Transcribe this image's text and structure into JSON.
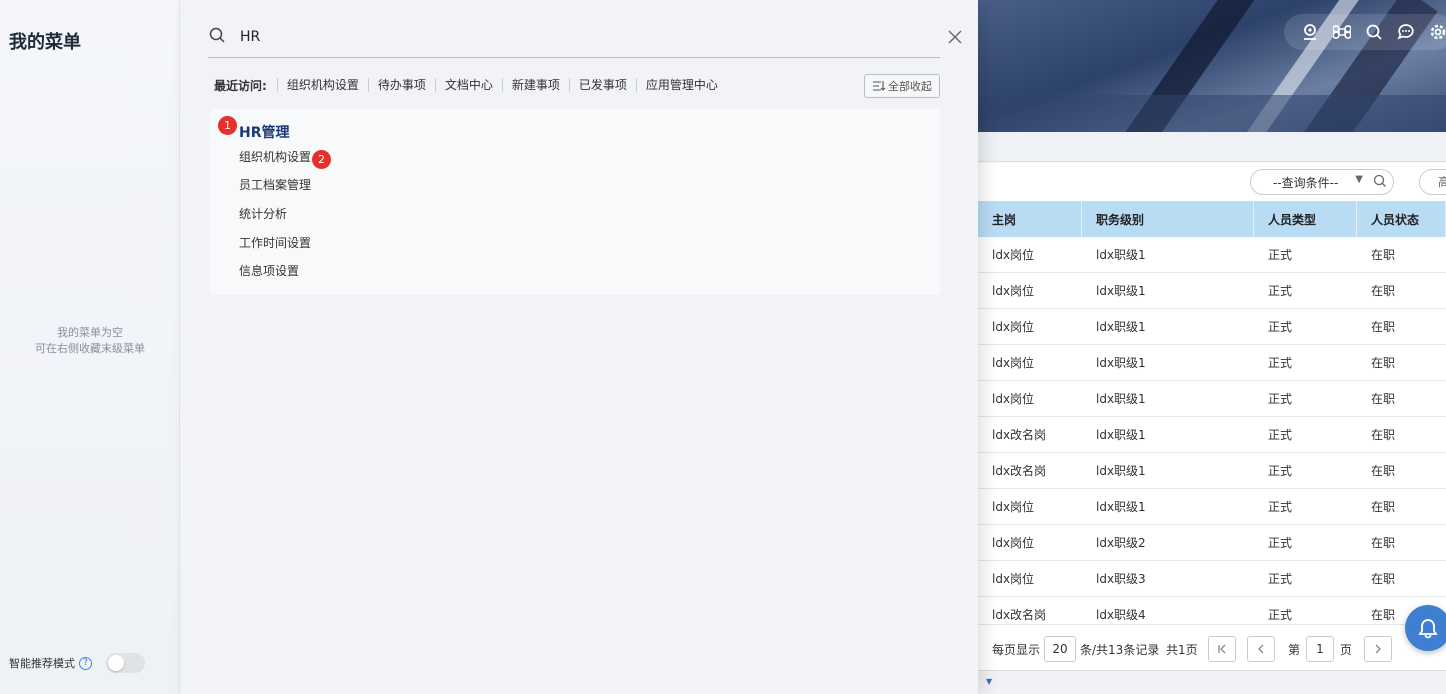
{
  "my_menu": {
    "title": "我的菜单",
    "empty_line1": "我的菜单为空",
    "empty_line2": "可在右侧收藏末级菜单",
    "smart_mode_label": "智能推荐模式",
    "smart_mode_enabled": false
  },
  "search": {
    "value": "HR",
    "recent_label": "最近访问:",
    "recent_items": [
      "组织机构设置",
      "待办事项",
      "文档中心",
      "新建事项",
      "已发事项",
      "应用管理中心"
    ],
    "collapse_all_label": "全部收起",
    "results": {
      "group_title": "HR管理",
      "group_badge": "1",
      "item_badge": "2",
      "items": [
        "组织机构设置",
        "员工档案管理",
        "统计分析",
        "工作时间设置",
        "信息项设置"
      ]
    }
  },
  "background": {
    "query_select": "--查询条件--",
    "query_btn2_text": "高",
    "table": {
      "headers": [
        "主岗",
        "职务级别",
        "人员类型",
        "人员状态"
      ],
      "rows": [
        [
          "ldx岗位",
          "ldx职级1",
          "正式",
          "在职"
        ],
        [
          "ldx岗位",
          "ldx职级1",
          "正式",
          "在职"
        ],
        [
          "ldx岗位",
          "ldx职级1",
          "正式",
          "在职"
        ],
        [
          "ldx岗位",
          "ldx职级1",
          "正式",
          "在职"
        ],
        [
          "ldx岗位",
          "ldx职级1",
          "正式",
          "在职"
        ],
        [
          "ldx改名岗",
          "ldx职级1",
          "正式",
          "在职"
        ],
        [
          "ldx改名岗",
          "ldx职级1",
          "正式",
          "在职"
        ],
        [
          "ldx岗位",
          "ldx职级1",
          "正式",
          "在职"
        ],
        [
          "ldx岗位",
          "ldx职级2",
          "正式",
          "在职"
        ],
        [
          "ldx岗位",
          "ldx职级3",
          "正式",
          "在职"
        ],
        [
          "ldx改名岗",
          "ldx职级4",
          "正式",
          "在职"
        ]
      ]
    },
    "pager": {
      "per_page_label": "每页显示",
      "per_page_value": "20",
      "summary": "条/共13条记录",
      "total_pages": "共1页",
      "page_prefix": "第",
      "page_value": "1",
      "page_suffix": "页"
    },
    "icons": [
      "location-icon",
      "command-icon",
      "search-icon",
      "chat-icon",
      "settings-icon"
    ]
  },
  "colors": {
    "badge": "#e8302a",
    "group_title": "#1b3a75",
    "table_header": "#b9dcf5",
    "accent": "#3c86e6"
  }
}
